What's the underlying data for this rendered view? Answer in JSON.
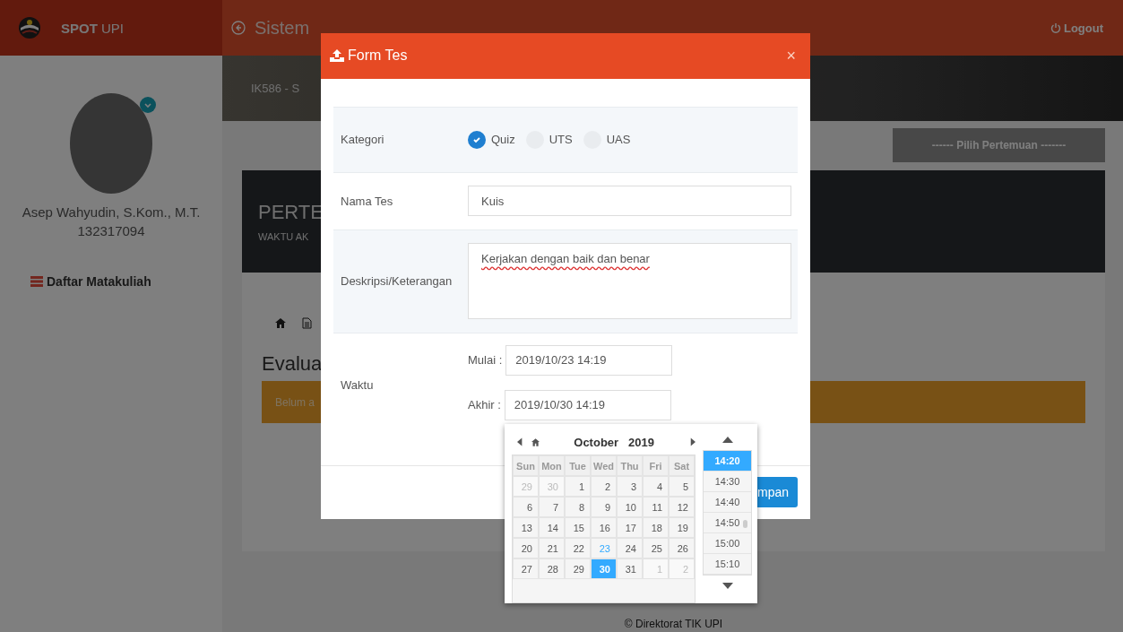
{
  "header": {
    "brand_bold": "SPOT",
    "brand": "UPI",
    "title": "Sistem",
    "logout": "Logout"
  },
  "sidebar": {
    "name": "Asep Wahyudin, S.Kom., M.T.",
    "id": "132317094",
    "menu": "Daftar Matakuliah"
  },
  "main": {
    "course": "IK586 - S",
    "select": "------ Pilih Pertemuan -------",
    "banner_title": "PERTE",
    "banner_sub": "WAKTU AK",
    "heading": "Evalua",
    "alert": "Belum a",
    "footer": "© Direktorat TIK UPI"
  },
  "modal": {
    "title": "Form Tes",
    "close": "×",
    "kategori": {
      "label": "Kategori",
      "options": [
        {
          "label": "Quiz",
          "selected": true
        },
        {
          "label": "UTS",
          "selected": false
        },
        {
          "label": "UAS",
          "selected": false
        }
      ]
    },
    "nama": {
      "label": "Nama Tes",
      "value": "Kuis"
    },
    "deskripsi": {
      "label": "Deskripsi/Keterangan",
      "value": "Kerjakan dengan baik dan benar"
    },
    "waktu": {
      "label": "Waktu",
      "start_label": "Mulai :",
      "start_value": "2019/10/23 14:19",
      "end_label": "Akhir :",
      "end_value": "2019/10/30 14:19"
    },
    "save": "mpan"
  },
  "datepicker": {
    "month": "October",
    "year": "2019",
    "weekdays": [
      "Sun",
      "Mon",
      "Tue",
      "Wed",
      "Thu",
      "Fri",
      "Sat"
    ],
    "days": [
      {
        "label": "29",
        "muted": true,
        "highlighted": false,
        "selected": false
      },
      {
        "label": "30",
        "muted": true,
        "highlighted": false,
        "selected": false
      },
      {
        "label": "1",
        "muted": false,
        "highlighted": false,
        "selected": false
      },
      {
        "label": "2",
        "muted": false,
        "highlighted": false,
        "selected": false
      },
      {
        "label": "3",
        "muted": false,
        "highlighted": false,
        "selected": false
      },
      {
        "label": "4",
        "muted": false,
        "highlighted": false,
        "selected": false
      },
      {
        "label": "5",
        "muted": false,
        "highlighted": false,
        "selected": false
      },
      {
        "label": "6",
        "muted": false,
        "highlighted": false,
        "selected": false
      },
      {
        "label": "7",
        "muted": false,
        "highlighted": false,
        "selected": false
      },
      {
        "label": "8",
        "muted": false,
        "highlighted": false,
        "selected": false
      },
      {
        "label": "9",
        "muted": false,
        "highlighted": false,
        "selected": false
      },
      {
        "label": "10",
        "muted": false,
        "highlighted": false,
        "selected": false
      },
      {
        "label": "11",
        "muted": false,
        "highlighted": false,
        "selected": false
      },
      {
        "label": "12",
        "muted": false,
        "highlighted": false,
        "selected": false
      },
      {
        "label": "13",
        "muted": false,
        "highlighted": false,
        "selected": false
      },
      {
        "label": "14",
        "muted": false,
        "highlighted": false,
        "selected": false
      },
      {
        "label": "15",
        "muted": false,
        "highlighted": false,
        "selected": false
      },
      {
        "label": "16",
        "muted": false,
        "highlighted": false,
        "selected": false
      },
      {
        "label": "17",
        "muted": false,
        "highlighted": false,
        "selected": false
      },
      {
        "label": "18",
        "muted": false,
        "highlighted": false,
        "selected": false
      },
      {
        "label": "19",
        "muted": false,
        "highlighted": false,
        "selected": false
      },
      {
        "label": "20",
        "muted": false,
        "highlighted": false,
        "selected": false
      },
      {
        "label": "21",
        "muted": false,
        "highlighted": false,
        "selected": false
      },
      {
        "label": "22",
        "muted": false,
        "highlighted": false,
        "selected": false
      },
      {
        "label": "23",
        "muted": false,
        "highlighted": true,
        "selected": false
      },
      {
        "label": "24",
        "muted": false,
        "highlighted": false,
        "selected": false
      },
      {
        "label": "25",
        "muted": false,
        "highlighted": false,
        "selected": false
      },
      {
        "label": "26",
        "muted": false,
        "highlighted": false,
        "selected": false
      },
      {
        "label": "27",
        "muted": false,
        "highlighted": false,
        "selected": false
      },
      {
        "label": "28",
        "muted": false,
        "highlighted": false,
        "selected": false
      },
      {
        "label": "29",
        "muted": false,
        "highlighted": false,
        "selected": false
      },
      {
        "label": "30",
        "muted": false,
        "highlighted": false,
        "selected": true
      },
      {
        "label": "31",
        "muted": false,
        "highlighted": false,
        "selected": false
      },
      {
        "label": "1",
        "muted": true,
        "highlighted": false,
        "selected": false
      },
      {
        "label": "2",
        "muted": true,
        "highlighted": false,
        "selected": false
      }
    ],
    "times": [
      {
        "label": "14:20",
        "selected": true
      },
      {
        "label": "14:30",
        "selected": false
      },
      {
        "label": "14:40",
        "selected": false
      },
      {
        "label": "14:50",
        "selected": false
      },
      {
        "label": "15:00",
        "selected": false
      },
      {
        "label": "15:10",
        "selected": false
      }
    ]
  }
}
